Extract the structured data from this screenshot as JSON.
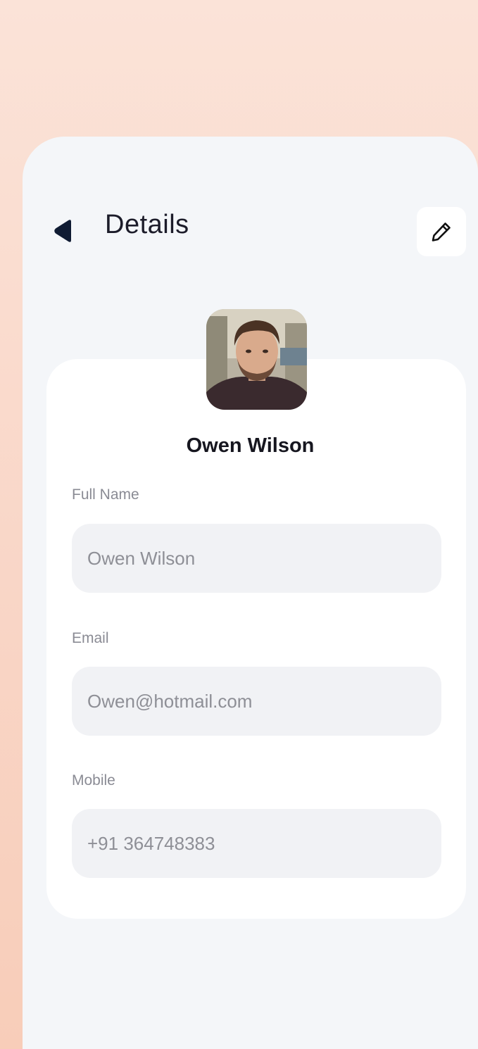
{
  "header": {
    "title": "Details",
    "back_icon": "back-arrow-icon",
    "edit_icon": "pencil-icon"
  },
  "profile": {
    "name": "Owen Wilson",
    "avatar": "profile-photo"
  },
  "fields": {
    "full_name": {
      "label": "Full Name",
      "value": "Owen Wilson"
    },
    "email": {
      "label": "Email",
      "value": "Owen@hotmail.com"
    },
    "mobile": {
      "label": "Mobile",
      "value": "+91 364748383"
    }
  },
  "colors": {
    "background_peach": "#fbe3d8",
    "screen": "#f4f6f9",
    "card": "#ffffff",
    "input_bg": "#f1f2f5",
    "icon_dark": "#0f1b33"
  }
}
